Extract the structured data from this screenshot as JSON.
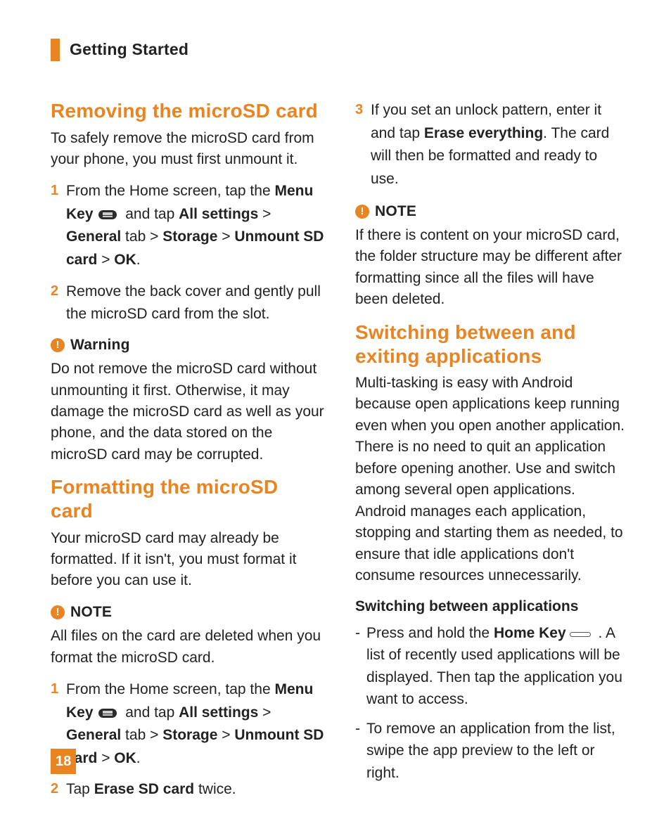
{
  "header": {
    "title": "Getting Started"
  },
  "pageNumber": "18",
  "left": {
    "s1": {
      "title": "Removing the microSD card",
      "intro": "To safely remove the microSD card from your phone, you must first unmount it.",
      "step1_a": "From the Home screen, tap the ",
      "step1_menu": "Menu Key",
      "step1_b": " and tap ",
      "allsettings": "All settings",
      "gt1": " > ",
      "general": "General",
      "tab": " tab > ",
      "storage": "Storage",
      "gt2": " > ",
      "unmount": "Unmount SD card",
      "gt3": " > ",
      "ok": "OK",
      "dot": ".",
      "step2": "Remove the back cover and gently pull the microSD card from the slot."
    },
    "warn": {
      "title": "Warning",
      "body": "Do not remove the microSD card without unmounting it first. Otherwise, it may damage the microSD card as well as your phone, and the data stored on the microSD card may be corrupted."
    },
    "s2": {
      "title": "Formatting the microSD card",
      "intro": "Your microSD card may already be formatted. If it isn't, you must format it before you can use it."
    },
    "note1": {
      "title": "NOTE",
      "body": "All files on the card are deleted when you format the microSD card."
    },
    "s2steps": {
      "step1_a": "From the Home screen, tap the ",
      "step2_a": "Tap ",
      "erase": "Erase SD card",
      "step2_b": " twice."
    }
  },
  "right": {
    "step3_a": "If you set an unlock pattern, enter it and tap ",
    "eraseeverything": "Erase everything",
    "step3_b": ". The card will then be formatted and ready to use.",
    "note2": {
      "title": "NOTE",
      "body": "If there is content on your microSD card, the folder structure may be different after formatting since all the files will have been deleted."
    },
    "s3": {
      "title": "Switching between and exiting applications",
      "body": "Multi-tasking is easy with Android because open applications keep running even when you open another application. There is no need to quit an application before opening another. Use and switch among several open applications. Android manages each application, stopping and starting them as needed, to ensure that idle applications don't consume resources unnecessarily."
    },
    "subhead": "Switching between applications",
    "dash1_a": "Press and hold the ",
    "homekey": "Home Key",
    "dash1_b": " . A list of recently used applications will be displayed. Then tap the application you want to access.",
    "dash2": "To remove an application from the list, swipe the app preview to the left or right."
  }
}
